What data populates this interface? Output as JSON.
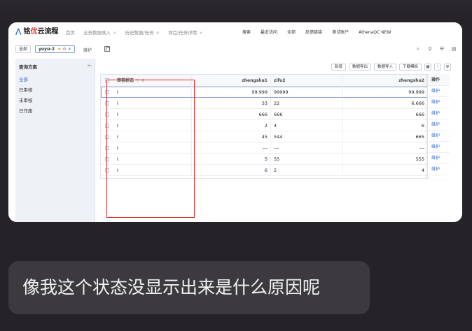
{
  "app": {
    "logo_prefix": "铭",
    "logo_accent": "优",
    "logo_suffix": "云流程",
    "nav": [
      {
        "label": "首页"
      },
      {
        "label": "业务数据录入"
      },
      {
        "label": "历史数据/任务"
      },
      {
        "label": "项目/任务详情"
      }
    ],
    "tools": [
      "搜索",
      "最近访问",
      "全部",
      "反馈链接",
      "测试账户",
      "AthenaQC NEW"
    ]
  },
  "tabs": {
    "all": "全部",
    "active": "yuyu-2",
    "maintain": "维护"
  },
  "sidebar": {
    "title": "查询方案",
    "items": [
      {
        "label": "全部"
      },
      {
        "label": "已审核"
      },
      {
        "label": "未审核"
      },
      {
        "label": "已作废"
      }
    ]
  },
  "toolbar": {
    "add": "新增",
    "export": "数据导出",
    "import": "数据导入",
    "template": "下载模板"
  },
  "table": {
    "headers": {
      "status": "审核状态",
      "zhengshu1": "zhengshu1",
      "zifu2": "zifu2",
      "zhengshu2": "zhengshu2",
      "ops": "操作"
    },
    "rows": [
      {
        "status": "I",
        "zhengshu1": "99,999",
        "zifu2": "99999",
        "zhengshu2": "99,999",
        "op": "维护"
      },
      {
        "status": "I",
        "zhengshu1": "33",
        "zifu2": "22",
        "zhengshu2": "6,666",
        "op": "维护"
      },
      {
        "status": "I",
        "zhengshu1": "666",
        "zifu2": "666",
        "zhengshu2": "666",
        "op": "维护"
      },
      {
        "status": "I",
        "zhengshu1": "2",
        "zifu2": "4",
        "zhengshu2": "6",
        "op": "维护"
      },
      {
        "status": "I",
        "zhengshu1": "45",
        "zifu2": "544",
        "zhengshu2": "665",
        "op": "维护"
      },
      {
        "status": "I",
        "zhengshu1": "---",
        "zifu2": "---",
        "zhengshu2": "---",
        "op": "维护"
      },
      {
        "status": "I",
        "zhengshu1": "5",
        "zifu2": "55",
        "zhengshu2": "555",
        "op": "维护"
      },
      {
        "status": "I",
        "zhengshu1": "6",
        "zifu2": "5",
        "zhengshu2": "4",
        "op": "维护"
      }
    ]
  },
  "message": {
    "text": "像我这个状态没显示出来是什么原因呢"
  },
  "colors": {
    "accent_blue": "#2b6cd8",
    "highlight_red": "#e22b2b",
    "background": "#252327",
    "bubble": "#3c3a3e"
  }
}
